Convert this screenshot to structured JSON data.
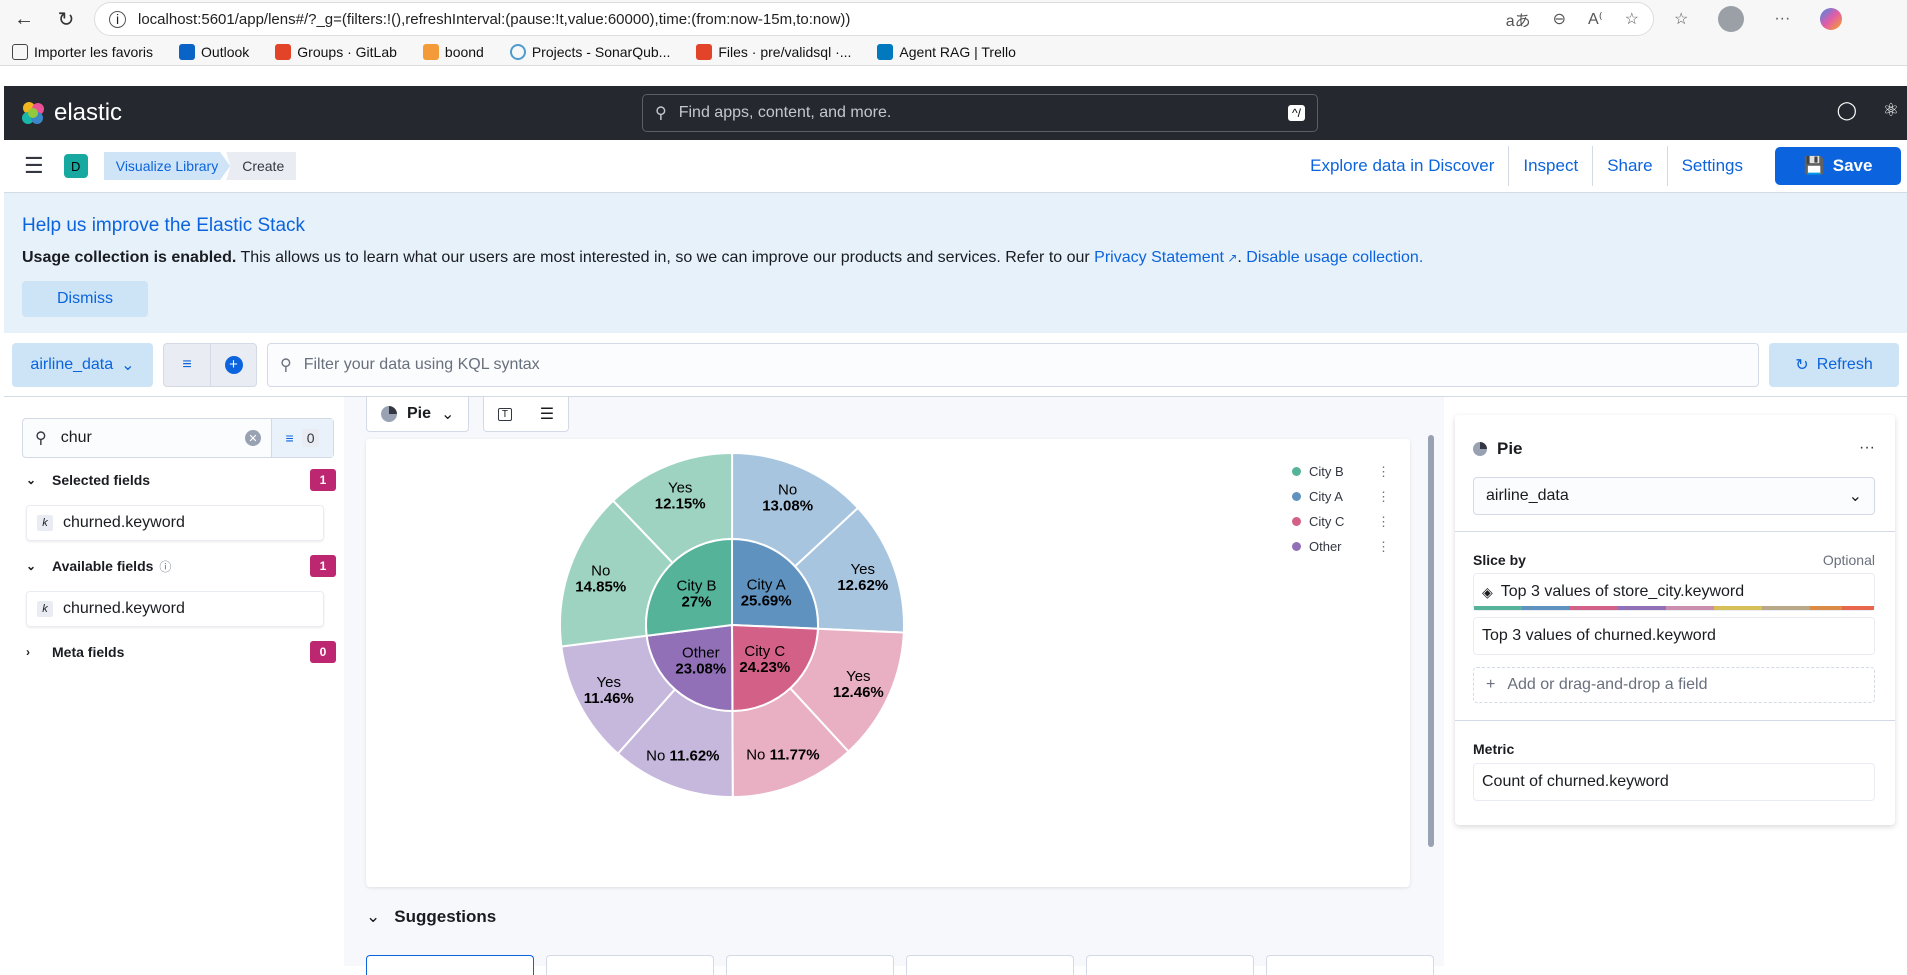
{
  "browser": {
    "url": "localhost:5601/app/lens#/?_g=(filters:!(),refreshInterval:(pause:!t,value:60000),time:(from:now-15m,to:now))",
    "bookmarks": [
      "Importer les favoris",
      "Outlook",
      "Groups · GitLab",
      "boond",
      "Projects - SonarQub...",
      "Files · pre/validsql ·...",
      "Agent RAG | Trello"
    ]
  },
  "header": {
    "logo_text": "elastic",
    "search_placeholder": "Find apps, content, and more.",
    "search_shortcut": "^/"
  },
  "toolbar": {
    "space_initial": "D",
    "breadcrumbs": [
      "Visualize Library",
      "Create"
    ],
    "links": [
      "Explore data in Discover",
      "Inspect",
      "Share",
      "Settings"
    ],
    "save_label": "Save"
  },
  "callout": {
    "title": "Help us improve the Elastic Stack",
    "bold": "Usage collection is enabled.",
    "text": " This allows us to learn what our users are most interested in, so we can improve our products and services. Refer to our ",
    "privacy_link": "Privacy Statement",
    "disable_link": "Disable usage collection.",
    "dismiss_label": "Dismiss"
  },
  "querybar": {
    "dataview": "airline_data",
    "kql_placeholder": "Filter your data using KQL syntax",
    "refresh_label": "Refresh"
  },
  "fields": {
    "search_value": "chur",
    "filter_count": "0",
    "selected": {
      "label": "Selected fields",
      "count": "1",
      "items": [
        "churned.keyword"
      ]
    },
    "available": {
      "label": "Available fields",
      "count": "1",
      "items": [
        "churned.keyword"
      ]
    },
    "meta": {
      "label": "Meta fields",
      "count": "0"
    }
  },
  "workspace": {
    "chart_type_label": "Pie",
    "suggestions_label": "Suggestions"
  },
  "chart_data": {
    "type": "pie",
    "title": "",
    "inner": [
      {
        "label": "City A",
        "value": 25.69,
        "color": "#6092c0"
      },
      {
        "label": "City C",
        "value": 24.23,
        "color": "#d36086"
      },
      {
        "label": "Other",
        "value": 23.08,
        "color": "#9170b8"
      },
      {
        "label": "City B",
        "value": 27,
        "color": "#54b399"
      }
    ],
    "outer": [
      {
        "parent": "City A",
        "label": "No",
        "value": 13.08,
        "color": "#a8c5e0"
      },
      {
        "parent": "City A",
        "label": "Yes",
        "value": 12.62,
        "color": "#a8c5e0"
      },
      {
        "parent": "City C",
        "label": "Yes",
        "value": 12.46,
        "color": "#e9afc2"
      },
      {
        "parent": "City C",
        "label": "No",
        "value": 11.77,
        "color": "#e9afc2"
      },
      {
        "parent": "Other",
        "label": "No",
        "value": 11.62,
        "color": "#c6b7dc"
      },
      {
        "parent": "Other",
        "label": "Yes",
        "value": 11.46,
        "color": "#c6b7dc"
      },
      {
        "parent": "City B",
        "label": "No",
        "value": 14.85,
        "color": "#9ed3c2"
      },
      {
        "parent": "City B",
        "label": "Yes",
        "value": 12.15,
        "color": "#9ed3c2"
      }
    ],
    "legend": [
      {
        "label": "City B",
        "color": "#54b399"
      },
      {
        "label": "City A",
        "color": "#6092c0"
      },
      {
        "label": "City C",
        "color": "#d36086"
      },
      {
        "label": "Other",
        "color": "#9170b8"
      }
    ],
    "legend_position": "top-right"
  },
  "config": {
    "title": "Pie",
    "dataview": "airline_data",
    "slice_by_label": "Slice by",
    "optional_label": "Optional",
    "slice_items": [
      "Top 3 values of store_city.keyword",
      "Top 3 values of churned.keyword"
    ],
    "add_field_label": "Add or drag-and-drop a field",
    "metric_label": "Metric",
    "metric_item": "Count of churned.keyword"
  }
}
